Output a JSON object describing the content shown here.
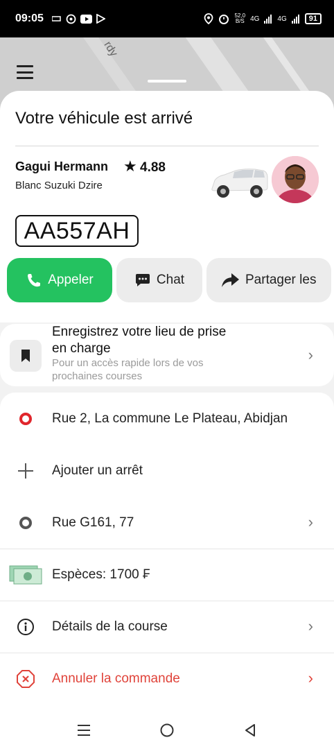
{
  "status_bar": {
    "time": "09:05",
    "net_speed": "52,0",
    "net_unit": "B/S",
    "signal1": "4G",
    "signal2": "4G",
    "battery": "91"
  },
  "map": {
    "street_label": "rdy"
  },
  "sheet": {
    "title": "Votre véhicule est arrivé",
    "driver": {
      "name": "Gagui Hermann",
      "rating": "4.88",
      "car": "Blanc Suzuki Dzire",
      "plate": "AA557AH"
    },
    "actions": {
      "call": "Appeler",
      "chat": "Chat",
      "share": "Partager les"
    }
  },
  "save_pickup": {
    "title": "Enregistrez votre lieu de prise en charge",
    "subtitle": "Pour un accès rapide lors de vos prochaines courses"
  },
  "route": {
    "pickup": "Rue 2, La commune Le Plateau, Abidjan",
    "add_stop": "Ajouter un arrêt",
    "destination": "Rue G161, 77",
    "payment": "Espèces: 1700 ₣",
    "details": "Détails de la course",
    "cancel": "Annuler la commande"
  },
  "colors": {
    "call_green": "#24c260",
    "cancel_red": "#e0433a",
    "pickup_red": "#e0262c"
  }
}
